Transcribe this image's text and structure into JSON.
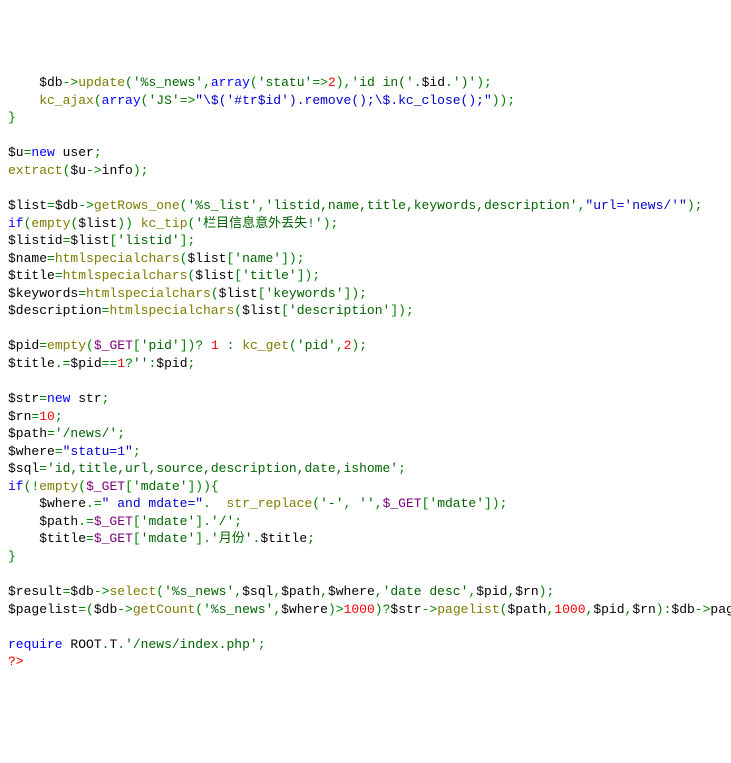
{
  "lines": [
    [
      {
        "c": "var",
        "t": "    $db"
      },
      {
        "c": "op",
        "t": "->"
      },
      {
        "c": "fn",
        "t": "update"
      },
      {
        "c": "br",
        "t": "("
      },
      {
        "c": "str-q",
        "t": "'%s_news'"
      },
      {
        "c": "op",
        "t": ","
      },
      {
        "c": "kw",
        "t": "array"
      },
      {
        "c": "br",
        "t": "("
      },
      {
        "c": "str-q",
        "t": "'statu'"
      },
      {
        "c": "op",
        "t": "=>"
      },
      {
        "c": "num",
        "t": "2"
      },
      {
        "c": "br",
        "t": ")"
      },
      {
        "c": "op",
        "t": ","
      },
      {
        "c": "str-q",
        "t": "'id in('"
      },
      {
        "c": "op",
        "t": "."
      },
      {
        "c": "var",
        "t": "$id"
      },
      {
        "c": "op",
        "t": "."
      },
      {
        "c": "str-q",
        "t": "')'"
      },
      {
        "c": "br",
        "t": ")"
      },
      {
        "c": "op",
        "t": ";"
      }
    ],
    [
      {
        "c": "var",
        "t": "    "
      },
      {
        "c": "fn",
        "t": "kc_ajax"
      },
      {
        "c": "br",
        "t": "("
      },
      {
        "c": "kw",
        "t": "array"
      },
      {
        "c": "br",
        "t": "("
      },
      {
        "c": "str-q",
        "t": "'JS'"
      },
      {
        "c": "op",
        "t": "=>"
      },
      {
        "c": "str-dq",
        "t": "\"\\$('#tr$id').remove();\\$.kc_close();\""
      },
      {
        "c": "br",
        "t": "))"
      },
      {
        "c": "op",
        "t": ";"
      }
    ],
    [
      {
        "c": "br",
        "t": "}"
      }
    ],
    [
      {
        "c": "var",
        "t": ""
      }
    ],
    [
      {
        "c": "var",
        "t": "$u"
      },
      {
        "c": "op",
        "t": "="
      },
      {
        "c": "kw",
        "t": "new"
      },
      {
        "c": "var",
        "t": " user"
      },
      {
        "c": "op",
        "t": ";"
      }
    ],
    [
      {
        "c": "fn",
        "t": "extract"
      },
      {
        "c": "br",
        "t": "("
      },
      {
        "c": "var",
        "t": "$u"
      },
      {
        "c": "op",
        "t": "->"
      },
      {
        "c": "var",
        "t": "info"
      },
      {
        "c": "br",
        "t": ")"
      },
      {
        "c": "op",
        "t": ";"
      }
    ],
    [
      {
        "c": "var",
        "t": ""
      }
    ],
    [
      {
        "c": "var",
        "t": "$list"
      },
      {
        "c": "op",
        "t": "="
      },
      {
        "c": "var",
        "t": "$db"
      },
      {
        "c": "op",
        "t": "->"
      },
      {
        "c": "fn",
        "t": "getRows_one"
      },
      {
        "c": "br",
        "t": "("
      },
      {
        "c": "str-q",
        "t": "'%s_list'"
      },
      {
        "c": "op",
        "t": ","
      },
      {
        "c": "str-q",
        "t": "'listid,name,title,keywords,description'"
      },
      {
        "c": "op",
        "t": ","
      },
      {
        "c": "str-dq",
        "t": "\"url='news/'\""
      },
      {
        "c": "br",
        "t": ")"
      },
      {
        "c": "op",
        "t": ";"
      }
    ],
    [
      {
        "c": "kw",
        "t": "if"
      },
      {
        "c": "br",
        "t": "("
      },
      {
        "c": "fn",
        "t": "empty"
      },
      {
        "c": "br",
        "t": "("
      },
      {
        "c": "var",
        "t": "$list"
      },
      {
        "c": "br",
        "t": "))"
      },
      {
        "c": "var",
        "t": " "
      },
      {
        "c": "fn",
        "t": "kc_tip"
      },
      {
        "c": "br",
        "t": "("
      },
      {
        "c": "str-q",
        "t": "'栏目信息意外丢失!'"
      },
      {
        "c": "br",
        "t": ")"
      },
      {
        "c": "op",
        "t": ";"
      }
    ],
    [
      {
        "c": "var",
        "t": "$listid"
      },
      {
        "c": "op",
        "t": "="
      },
      {
        "c": "var",
        "t": "$list"
      },
      {
        "c": "br",
        "t": "["
      },
      {
        "c": "str-q",
        "t": "'listid'"
      },
      {
        "c": "br",
        "t": "]"
      },
      {
        "c": "op",
        "t": ";"
      }
    ],
    [
      {
        "c": "var",
        "t": "$name"
      },
      {
        "c": "op",
        "t": "="
      },
      {
        "c": "fn",
        "t": "htmlspecialchars"
      },
      {
        "c": "br",
        "t": "("
      },
      {
        "c": "var",
        "t": "$list"
      },
      {
        "c": "br",
        "t": "["
      },
      {
        "c": "str-q",
        "t": "'name'"
      },
      {
        "c": "br",
        "t": "])"
      },
      {
        "c": "op",
        "t": ";"
      }
    ],
    [
      {
        "c": "var",
        "t": "$title"
      },
      {
        "c": "op",
        "t": "="
      },
      {
        "c": "fn",
        "t": "htmlspecialchars"
      },
      {
        "c": "br",
        "t": "("
      },
      {
        "c": "var",
        "t": "$list"
      },
      {
        "c": "br",
        "t": "["
      },
      {
        "c": "str-q",
        "t": "'title'"
      },
      {
        "c": "br",
        "t": "])"
      },
      {
        "c": "op",
        "t": ";"
      }
    ],
    [
      {
        "c": "var",
        "t": "$keywords"
      },
      {
        "c": "op",
        "t": "="
      },
      {
        "c": "fn",
        "t": "htmlspecialchars"
      },
      {
        "c": "br",
        "t": "("
      },
      {
        "c": "var",
        "t": "$list"
      },
      {
        "c": "br",
        "t": "["
      },
      {
        "c": "str-q",
        "t": "'keywords'"
      },
      {
        "c": "br",
        "t": "])"
      },
      {
        "c": "op",
        "t": ";"
      }
    ],
    [
      {
        "c": "var",
        "t": "$description"
      },
      {
        "c": "op",
        "t": "="
      },
      {
        "c": "fn",
        "t": "htmlspecialchars"
      },
      {
        "c": "br",
        "t": "("
      },
      {
        "c": "var",
        "t": "$list"
      },
      {
        "c": "br",
        "t": "["
      },
      {
        "c": "str-q",
        "t": "'description'"
      },
      {
        "c": "br",
        "t": "])"
      },
      {
        "c": "op",
        "t": ";"
      }
    ],
    [
      {
        "c": "var",
        "t": ""
      }
    ],
    [
      {
        "c": "var",
        "t": "$pid"
      },
      {
        "c": "op",
        "t": "="
      },
      {
        "c": "fn",
        "t": "empty"
      },
      {
        "c": "br",
        "t": "("
      },
      {
        "c": "purple",
        "t": "$_GET"
      },
      {
        "c": "br",
        "t": "["
      },
      {
        "c": "str-q",
        "t": "'pid'"
      },
      {
        "c": "br",
        "t": "])"
      },
      {
        "c": "op",
        "t": "?"
      },
      {
        "c": "var",
        "t": " "
      },
      {
        "c": "num",
        "t": "1"
      },
      {
        "c": "var",
        "t": " "
      },
      {
        "c": "op",
        "t": ":"
      },
      {
        "c": "var",
        "t": " "
      },
      {
        "c": "fn",
        "t": "kc_get"
      },
      {
        "c": "br",
        "t": "("
      },
      {
        "c": "str-q",
        "t": "'pid'"
      },
      {
        "c": "op",
        "t": ","
      },
      {
        "c": "num",
        "t": "2"
      },
      {
        "c": "br",
        "t": ")"
      },
      {
        "c": "op",
        "t": ";"
      }
    ],
    [
      {
        "c": "var",
        "t": "$title"
      },
      {
        "c": "op",
        "t": ".="
      },
      {
        "c": "var",
        "t": "$pid"
      },
      {
        "c": "op",
        "t": "=="
      },
      {
        "c": "num",
        "t": "1"
      },
      {
        "c": "op",
        "t": "?"
      },
      {
        "c": "str-q",
        "t": "''"
      },
      {
        "c": "op",
        "t": ":"
      },
      {
        "c": "var",
        "t": "$pid"
      },
      {
        "c": "op",
        "t": ";"
      }
    ],
    [
      {
        "c": "var",
        "t": ""
      }
    ],
    [
      {
        "c": "var",
        "t": "$str"
      },
      {
        "c": "op",
        "t": "="
      },
      {
        "c": "kw",
        "t": "new"
      },
      {
        "c": "var",
        "t": " str"
      },
      {
        "c": "op",
        "t": ";"
      }
    ],
    [
      {
        "c": "var",
        "t": "$rn"
      },
      {
        "c": "op",
        "t": "="
      },
      {
        "c": "num",
        "t": "10"
      },
      {
        "c": "op",
        "t": ";"
      }
    ],
    [
      {
        "c": "var",
        "t": "$path"
      },
      {
        "c": "op",
        "t": "="
      },
      {
        "c": "str-q",
        "t": "'/news/'"
      },
      {
        "c": "op",
        "t": ";"
      }
    ],
    [
      {
        "c": "var",
        "t": "$where"
      },
      {
        "c": "op",
        "t": "="
      },
      {
        "c": "str-dq",
        "t": "\"statu=1\""
      },
      {
        "c": "op",
        "t": ";"
      }
    ],
    [
      {
        "c": "var",
        "t": "$sql"
      },
      {
        "c": "op",
        "t": "="
      },
      {
        "c": "str-q",
        "t": "'id,title,url,source,description,date,ishome'"
      },
      {
        "c": "op",
        "t": ";"
      }
    ],
    [
      {
        "c": "kw",
        "t": "if"
      },
      {
        "c": "br",
        "t": "("
      },
      {
        "c": "op",
        "t": "!"
      },
      {
        "c": "fn",
        "t": "empty"
      },
      {
        "c": "br",
        "t": "("
      },
      {
        "c": "purple",
        "t": "$_GET"
      },
      {
        "c": "br",
        "t": "["
      },
      {
        "c": "str-q",
        "t": "'mdate'"
      },
      {
        "c": "br",
        "t": "])){"
      }
    ],
    [
      {
        "c": "var",
        "t": "    $where"
      },
      {
        "c": "op",
        "t": ".="
      },
      {
        "c": "str-dq",
        "t": "\" and mdate=\""
      },
      {
        "c": "op",
        "t": "."
      },
      {
        "c": "var",
        "t": "  "
      },
      {
        "c": "fn",
        "t": "str_replace"
      },
      {
        "c": "br",
        "t": "("
      },
      {
        "c": "str-q",
        "t": "'-'"
      },
      {
        "c": "op",
        "t": ","
      },
      {
        "c": "var",
        "t": " "
      },
      {
        "c": "str-q",
        "t": "''"
      },
      {
        "c": "op",
        "t": ","
      },
      {
        "c": "purple",
        "t": "$_GET"
      },
      {
        "c": "br",
        "t": "["
      },
      {
        "c": "str-q",
        "t": "'mdate'"
      },
      {
        "c": "br",
        "t": "])"
      },
      {
        "c": "op",
        "t": ";"
      }
    ],
    [
      {
        "c": "var",
        "t": "    $path"
      },
      {
        "c": "op",
        "t": ".="
      },
      {
        "c": "purple",
        "t": "$_GET"
      },
      {
        "c": "br",
        "t": "["
      },
      {
        "c": "str-q",
        "t": "'mdate'"
      },
      {
        "c": "br",
        "t": "]"
      },
      {
        "c": "op",
        "t": "."
      },
      {
        "c": "str-q",
        "t": "'/'"
      },
      {
        "c": "op",
        "t": ";"
      }
    ],
    [
      {
        "c": "var",
        "t": "    $title"
      },
      {
        "c": "op",
        "t": "="
      },
      {
        "c": "purple",
        "t": "$_GET"
      },
      {
        "c": "br",
        "t": "["
      },
      {
        "c": "str-q",
        "t": "'mdate'"
      },
      {
        "c": "br",
        "t": "]"
      },
      {
        "c": "op",
        "t": "."
      },
      {
        "c": "str-q",
        "t": "'月份'"
      },
      {
        "c": "op",
        "t": "."
      },
      {
        "c": "var",
        "t": "$title"
      },
      {
        "c": "op",
        "t": ";"
      }
    ],
    [
      {
        "c": "br",
        "t": "}"
      }
    ],
    [
      {
        "c": "var",
        "t": ""
      }
    ],
    [
      {
        "c": "var",
        "t": "$result"
      },
      {
        "c": "op",
        "t": "="
      },
      {
        "c": "var",
        "t": "$db"
      },
      {
        "c": "op",
        "t": "->"
      },
      {
        "c": "fn",
        "t": "select"
      },
      {
        "c": "br",
        "t": "("
      },
      {
        "c": "str-q",
        "t": "'%s_news'"
      },
      {
        "c": "op",
        "t": ","
      },
      {
        "c": "var",
        "t": "$sql"
      },
      {
        "c": "op",
        "t": ","
      },
      {
        "c": "var",
        "t": "$path"
      },
      {
        "c": "op",
        "t": ","
      },
      {
        "c": "var",
        "t": "$where"
      },
      {
        "c": "op",
        "t": ","
      },
      {
        "c": "str-q",
        "t": "'date desc'"
      },
      {
        "c": "op",
        "t": ","
      },
      {
        "c": "var",
        "t": "$pid"
      },
      {
        "c": "op",
        "t": ","
      },
      {
        "c": "var",
        "t": "$rn"
      },
      {
        "c": "br",
        "t": ")"
      },
      {
        "c": "op",
        "t": ";"
      }
    ],
    [
      {
        "c": "var",
        "t": "$pagelist"
      },
      {
        "c": "op",
        "t": "="
      },
      {
        "c": "br",
        "t": "("
      },
      {
        "c": "var",
        "t": "$db"
      },
      {
        "c": "op",
        "t": "->"
      },
      {
        "c": "fn",
        "t": "getCount"
      },
      {
        "c": "br",
        "t": "("
      },
      {
        "c": "str-q",
        "t": "'%s_news'"
      },
      {
        "c": "op",
        "t": ","
      },
      {
        "c": "var",
        "t": "$where"
      },
      {
        "c": "br",
        "t": ")"
      },
      {
        "c": "op",
        "t": ">"
      },
      {
        "c": "num",
        "t": "1000"
      },
      {
        "c": "br",
        "t": ")"
      },
      {
        "c": "op",
        "t": "?"
      },
      {
        "c": "var",
        "t": "$str"
      },
      {
        "c": "op",
        "t": "->"
      },
      {
        "c": "fn",
        "t": "pagelist"
      },
      {
        "c": "br",
        "t": "("
      },
      {
        "c": "var",
        "t": "$path"
      },
      {
        "c": "op",
        "t": ","
      },
      {
        "c": "num",
        "t": "1000"
      },
      {
        "c": "op",
        "t": ","
      },
      {
        "c": "var",
        "t": "$pid"
      },
      {
        "c": "op",
        "t": ","
      },
      {
        "c": "var",
        "t": "$rn"
      },
      {
        "c": "br",
        "t": ")"
      },
      {
        "c": "op",
        "t": ":"
      },
      {
        "c": "var",
        "t": "$db"
      },
      {
        "c": "op",
        "t": "->"
      },
      {
        "c": "var",
        "t": "pagelist"
      },
      {
        "c": "op",
        "t": ";"
      }
    ],
    [
      {
        "c": "var",
        "t": ""
      }
    ],
    [
      {
        "c": "kw",
        "t": "require"
      },
      {
        "c": "var",
        "t": " ROOT"
      },
      {
        "c": "op",
        "t": "."
      },
      {
        "c": "var",
        "t": "T"
      },
      {
        "c": "op",
        "t": "."
      },
      {
        "c": "str-q",
        "t": "'/news/index.php'"
      },
      {
        "c": "op",
        "t": ";"
      }
    ],
    [
      {
        "c": "red",
        "t": "?>"
      }
    ]
  ]
}
